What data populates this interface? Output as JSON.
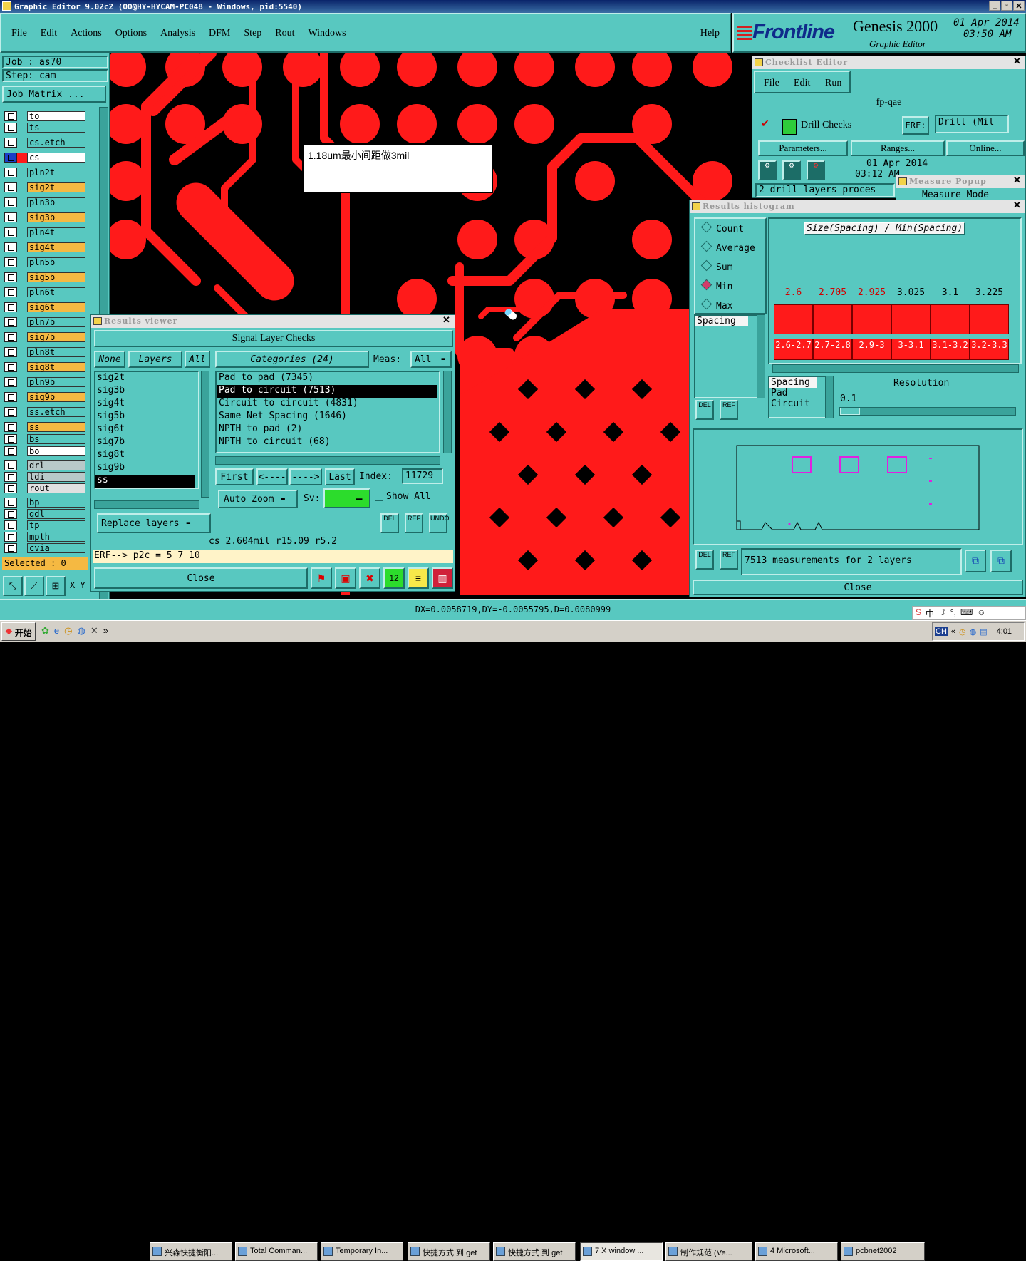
{
  "window": {
    "title": "Graphic Editor 9.02c2 (OO@HY-HYCAM-PC048 - Windows, pid:5540)"
  },
  "menu": [
    "File",
    "Edit",
    "Actions",
    "Options",
    "Analysis",
    "DFM",
    "Step",
    "Rout",
    "Windows"
  ],
  "help": "Help",
  "brand": {
    "logo": "Frontline",
    "product": "Genesis 2000",
    "subtitle": "Graphic Editor",
    "date": "01 Apr 2014",
    "time": "03:50 AM"
  },
  "job": {
    "job_label": "Job : as70",
    "step_label": "Step: cam",
    "matrix_btn": "Job Matrix ..."
  },
  "layers": [
    {
      "name": "to",
      "color": "#ffffff"
    },
    {
      "name": "ts",
      "color": "#58c8c0"
    },
    {
      "name": "cs.etch",
      "color": "#58c8c0"
    },
    {
      "name": "cs",
      "color": "#ffffff"
    },
    {
      "name": "pln2t",
      "color": "#58c8c0"
    },
    {
      "name": "sig2t",
      "color": "#f5b942"
    },
    {
      "name": "pln3b",
      "color": "#58c8c0"
    },
    {
      "name": "sig3b",
      "color": "#f5b942"
    },
    {
      "name": "pln4t",
      "color": "#58c8c0"
    },
    {
      "name": "sig4t",
      "color": "#f5b942"
    },
    {
      "name": "pln5b",
      "color": "#58c8c0"
    },
    {
      "name": "sig5b",
      "color": "#f5b942"
    },
    {
      "name": "pln6t",
      "color": "#58c8c0"
    },
    {
      "name": "sig6t",
      "color": "#f5b942"
    },
    {
      "name": "pln7b",
      "color": "#58c8c0"
    },
    {
      "name": "sig7b",
      "color": "#f5b942"
    },
    {
      "name": "pln8t",
      "color": "#58c8c0"
    },
    {
      "name": "sig8t",
      "color": "#f5b942"
    },
    {
      "name": "pln9b",
      "color": "#58c8c0"
    },
    {
      "name": "sig9b",
      "color": "#f5b942"
    },
    {
      "name": "ss.etch",
      "color": "#58c8c0"
    },
    {
      "name": "ss",
      "color": "#f5b942"
    },
    {
      "name": "bs",
      "color": "#58c8c0"
    },
    {
      "name": "bo",
      "color": "#ffffff"
    },
    {
      "name": "drl",
      "color": "#b8c8c8"
    },
    {
      "name": "ldi",
      "color": "#b8c8c8"
    },
    {
      "name": "rout",
      "color": "#e0e0e0"
    },
    {
      "name": "bp",
      "color": "#58c8c0"
    },
    {
      "name": "gdl",
      "color": "#58c8c0"
    },
    {
      "name": "tp",
      "color": "#58c8c0"
    },
    {
      "name": "mpth",
      "color": "#58c8c0"
    },
    {
      "name": "cvia",
      "color": "#58c8c0"
    }
  ],
  "selected": "Selected : 0",
  "xy_label": "X Y",
  "annotation": "1.18um最小间距做3mil",
  "checklist": {
    "title": "Checklist Editor",
    "menu": [
      "File",
      "Edit",
      "Run"
    ],
    "name": "fp-qae",
    "check_name": "Drill Checks",
    "erf_label": "ERF:",
    "erf_value": "Drill (Mil",
    "params": "Parameters...",
    "ranges": "Ranges...",
    "online": "Online...",
    "date": "01 Apr 2014",
    "time": "03:12 AM",
    "status": "2 drill layers proces"
  },
  "measure": {
    "title": "Measure Popup",
    "mode": "Measure Mode"
  },
  "histogram": {
    "title": "Results histogram",
    "options": [
      "Count",
      "Average",
      "Sum",
      "Min",
      "Max"
    ],
    "selected": "Min",
    "header": "Size(Spacing) / Min(Spacing)",
    "list1": [
      "Spacing"
    ],
    "list2": [
      "Spacing",
      "Pad",
      "Circuit"
    ],
    "resolution_label": "Resolution",
    "resolution": "0.1",
    "status": "7513 measurements for 2 layers",
    "close": "Close"
  },
  "chart_data": {
    "type": "bar",
    "title": "Size(Spacing) / Min(Spacing)",
    "categories": [
      "2.6-2.7",
      "2.7-2.8",
      "2.9-3",
      "3-3.1",
      "3.1-3.2",
      "3.2-3.3"
    ],
    "values": [
      2.6,
      2.705,
      2.925,
      3.025,
      3.1,
      3.225
    ],
    "value_labels": [
      "2.6",
      "2.705",
      "2.925",
      "3.025",
      "3.1",
      "3.225"
    ],
    "highlight_colors": [
      "#d00000",
      "#d00000",
      "#d00000",
      "#000000",
      "#000000",
      "#000000"
    ]
  },
  "viewer": {
    "title": "Results viewer",
    "heading": "Signal Layer Checks",
    "none": "None",
    "layers_btn": "Layers",
    "all": "All",
    "categories": "Categories (24)",
    "meas_label": "Meas:",
    "meas_value": "All",
    "layers": [
      "sig2t",
      "sig3b",
      "sig4t",
      "sig5b",
      "sig6t",
      "sig7b",
      "sig8t",
      "sig9b",
      "ss"
    ],
    "checks": [
      "Pad to pad (7345)",
      "Pad to circuit (7513)",
      "Circuit to circuit (4831)",
      "Same Net Spacing (1646)",
      "NPTH to pad (2)",
      "NPTH to circuit (68)"
    ],
    "first": "First",
    "prev": "<----",
    "next": "---->",
    "last": "Last",
    "index_label": "Index:",
    "index": "11729",
    "auto_zoom": "Auto Zoom",
    "sv": "Sv:",
    "show_all": "Show All",
    "replace": "Replace layers",
    "status": "cs 2.604mil  r15.09  r5.2",
    "erf": "ERF--> p2c = 5 7 10",
    "close": "Close"
  },
  "icon_labels": {
    "del": "DEL",
    "ref": "REF",
    "undo": "UNDO"
  },
  "coords": "DX=0.0058719,DY=-0.0055795,D=0.0080999",
  "taskbar": {
    "start": "开始",
    "items": [
      "兴森快捷衡阳...",
      "Total Comman...",
      "Temporary In...",
      "快捷方式 到 get",
      "快捷方式 到 get",
      "7 X window ...",
      "制作规范 (Ve...",
      "4 Microsoft...",
      "pcbnet2002"
    ],
    "clock": "4:01",
    "ime": "中",
    "ime_lang": "CH"
  }
}
